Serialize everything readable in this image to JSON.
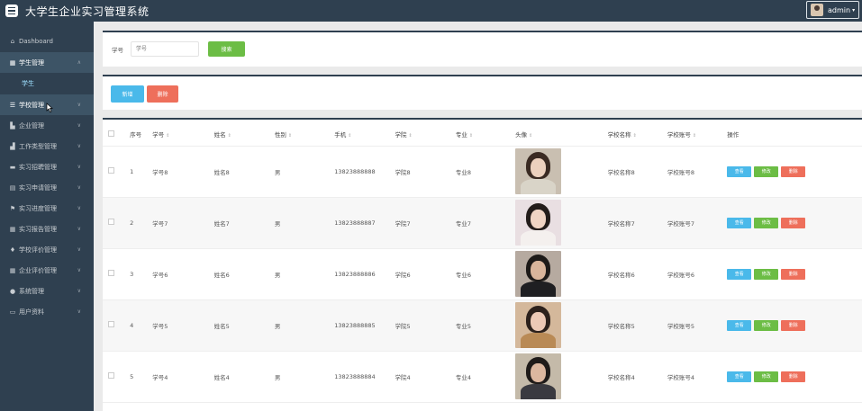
{
  "header": {
    "title": "大学生企业实习管理系统",
    "user": "admin"
  },
  "sidebar": {
    "items": [
      {
        "label": "Dashboard",
        "icon": "home-icon"
      },
      {
        "label": "学生管理",
        "icon": "grid-icon"
      },
      {
        "label": "学生",
        "icon": ""
      },
      {
        "label": "学校管理",
        "icon": "list-icon"
      },
      {
        "label": "企业管理",
        "icon": "building-icon"
      },
      {
        "label": "工作类型管理",
        "icon": "bar-chart-icon"
      },
      {
        "label": "实习招聘管理",
        "icon": "briefcase-icon"
      },
      {
        "label": "实习申请管理",
        "icon": "list-icon"
      },
      {
        "label": "实习进度管理",
        "icon": "flag-icon"
      },
      {
        "label": "实习报告管理",
        "icon": "grid-icon"
      },
      {
        "label": "学校评价管理",
        "icon": "thumbs-up-icon"
      },
      {
        "label": "企业评价管理",
        "icon": "grid-icon"
      },
      {
        "label": "系统管理",
        "icon": "user-icon"
      },
      {
        "label": "用户资料",
        "icon": "id-card-icon"
      }
    ]
  },
  "search": {
    "label": "学号",
    "placeholder": "学号",
    "button": "搜索"
  },
  "actions": {
    "add": "新增",
    "delete": "删除"
  },
  "table": {
    "columns": [
      "序号",
      "学号",
      "姓名",
      "性别",
      "手机",
      "学院",
      "专业",
      "头像",
      "学校名称",
      "学校账号",
      "操作"
    ],
    "row_buttons": {
      "view": "查看",
      "edit": "修改",
      "delete": "删除"
    },
    "rows": [
      {
        "idx": "1",
        "sid": "学号8",
        "name": "姓名8",
        "gender": "男",
        "phone": "13823888888",
        "college": "学院8",
        "major": "专业8",
        "school": "学校名称8",
        "account": "学校账号8"
      },
      {
        "idx": "2",
        "sid": "学号7",
        "name": "姓名7",
        "gender": "男",
        "phone": "13823888887",
        "college": "学院7",
        "major": "专业7",
        "school": "学校名称7",
        "account": "学校账号7"
      },
      {
        "idx": "3",
        "sid": "学号6",
        "name": "姓名6",
        "gender": "男",
        "phone": "13823888886",
        "college": "学院6",
        "major": "专业6",
        "school": "学校名称6",
        "account": "学校账号6"
      },
      {
        "idx": "4",
        "sid": "学号5",
        "name": "姓名5",
        "gender": "男",
        "phone": "13823888885",
        "college": "学院5",
        "major": "专业5",
        "school": "学校名称5",
        "account": "学校账号5"
      },
      {
        "idx": "5",
        "sid": "学号4",
        "name": "姓名4",
        "gender": "男",
        "phone": "13823888884",
        "college": "学院4",
        "major": "专业4",
        "school": "学校名称4",
        "account": "学校账号4"
      }
    ]
  },
  "colors": {
    "sidebar": "#2f4050",
    "primary": "#4ab9ea",
    "success": "#6cbd45",
    "danger": "#ee6f5b"
  }
}
